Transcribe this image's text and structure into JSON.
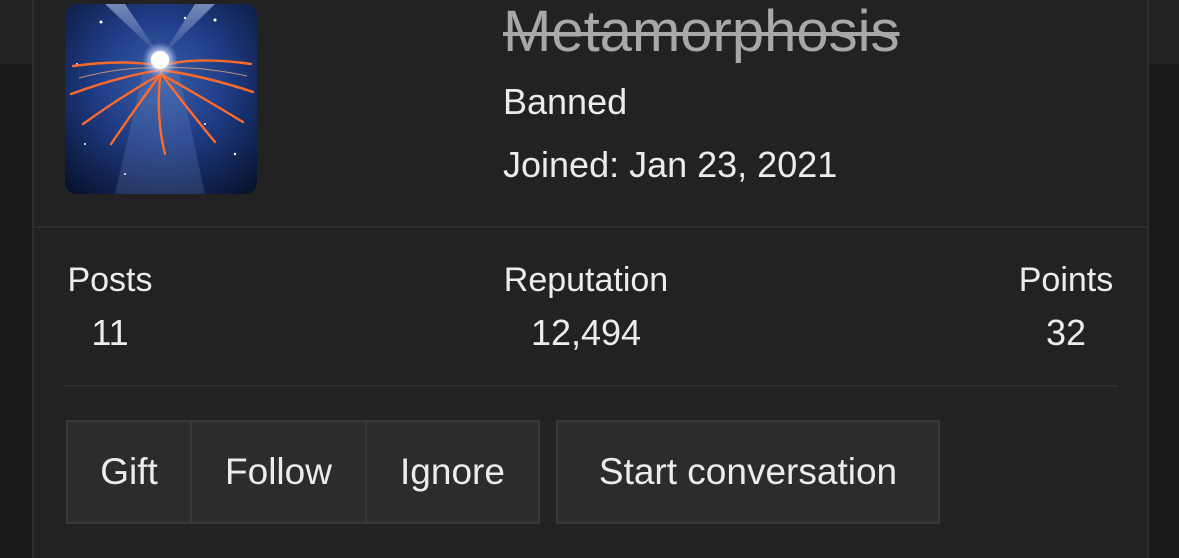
{
  "profile": {
    "username": "Metamorphosis",
    "user_title": "Banned",
    "joined": "Joined: Jan 23, 2021"
  },
  "stats": [
    {
      "label": "Posts",
      "value": "11"
    },
    {
      "label": "Reputation",
      "value": "12,494"
    },
    {
      "label": "Points",
      "value": "32"
    }
  ],
  "actions": {
    "gift": "Gift",
    "follow": "Follow",
    "ignore": "Ignore",
    "start_conversation": "Start conversation"
  },
  "colors": {
    "background": "#1a1a1a",
    "card": "#222222",
    "username_banned": "#a8a8a8",
    "text": "#ececec",
    "button": "#2c2c2c"
  }
}
